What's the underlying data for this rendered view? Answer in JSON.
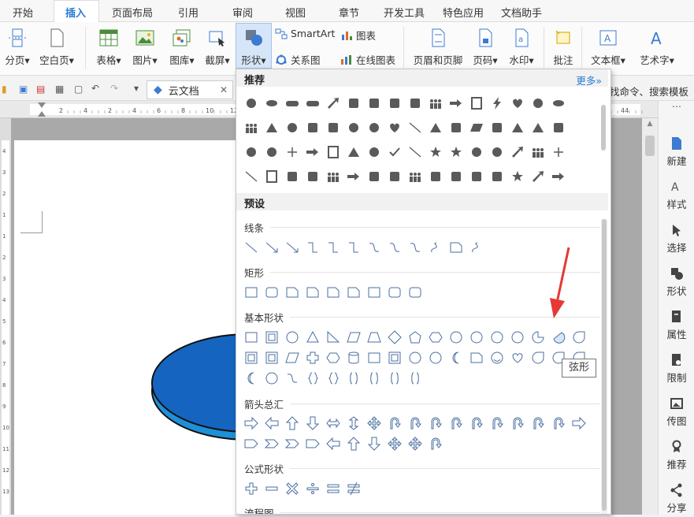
{
  "tabs": [
    "开始",
    "插入",
    "页面布局",
    "引用",
    "审阅",
    "视图",
    "章节",
    "开发工具",
    "特色应用",
    "文档助手"
  ],
  "active_tab": "插入",
  "ribbon": {
    "fenye": "分页",
    "kongbai": "空白页",
    "biaoge": "表格",
    "tupian": "图片",
    "tuku": "图库",
    "jietu": "截屏",
    "xingzhuang": "形状",
    "smartart": "SmartArt",
    "tubiao": "图表",
    "guanxitu": "关系图",
    "zaixiantubiao": "在线图表",
    "yemei": "页眉和页脚",
    "yema": "页码",
    "shuiyin": "水印",
    "pizhu": "批注",
    "wenbenkuang": "文本框",
    "yishuzi": "艺术字"
  },
  "quick_access": {
    "tab_label": "云文档",
    "search_hint": "找命令、搜索模板"
  },
  "ruler_marks": [
    "2",
    "4",
    "2",
    "4",
    "6",
    "8",
    "10",
    "12",
    "14",
    "16",
    "18",
    "20",
    "22",
    "24",
    "26",
    "28",
    "30",
    "32",
    "34",
    "36",
    "38",
    "40",
    "42",
    "44"
  ],
  "vruler_marks": [
    "4",
    "3",
    "2",
    "1",
    "1",
    "2",
    "3",
    "4",
    "5",
    "6",
    "7",
    "8",
    "9",
    "10",
    "11",
    "12",
    "13"
  ],
  "sidebar": [
    "新建",
    "样式",
    "选择",
    "形状",
    "属性",
    "限制",
    "传图",
    "推荐",
    "分享"
  ],
  "panel": {
    "recommended": "推荐",
    "more": "更多»",
    "preset": "预设",
    "sections": {
      "lines": "线条",
      "rect": "矩形",
      "basic": "基本形状",
      "arrows": "箭头总汇",
      "formula": "公式形状",
      "flow": "流程图"
    }
  },
  "tooltip": "弦形",
  "colors": {
    "accent": "#2a7ad6",
    "ellipse_fill": "#1565c0",
    "ellipse_side": "#1e90d8",
    "arrow_red": "#e53935"
  }
}
